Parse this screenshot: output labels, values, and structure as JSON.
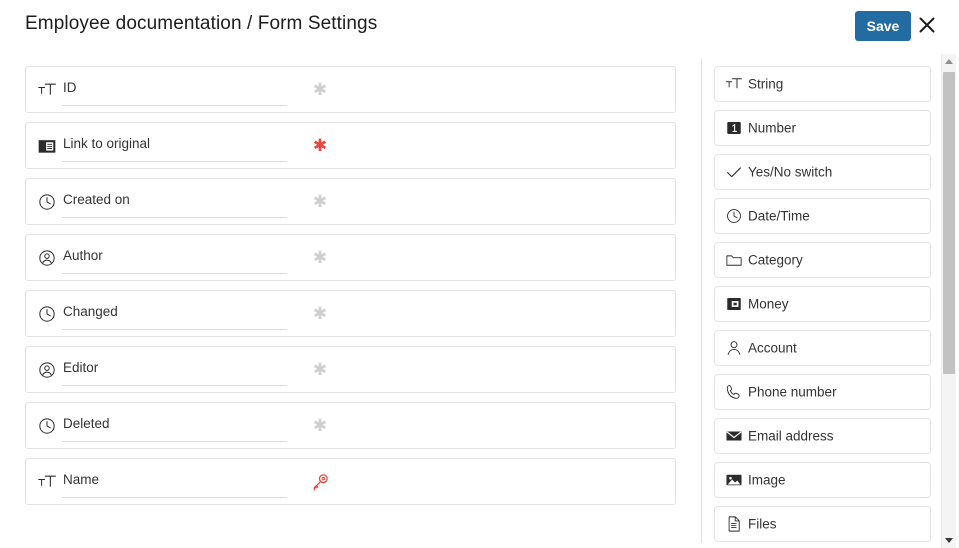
{
  "header": {
    "title": "Employee documentation / Form Settings",
    "save_label": "Save",
    "close_icon": "close-icon",
    "accent_color": "#236ca3"
  },
  "colors": {
    "accent": "#236ca3",
    "required_marker": "#e8453c",
    "optional_marker": "#cfcfcf",
    "key_marker": "#e8453c",
    "row_border": "#e3e3e3",
    "text": "#333333"
  },
  "form": {
    "rows": [
      {
        "label": "ID",
        "icon": "text-format-icon",
        "marker": "asterisk",
        "marker_tone": "grey"
      },
      {
        "label": "Link to original",
        "icon": "page-layout-icon",
        "marker": "asterisk",
        "marker_tone": "red"
      },
      {
        "label": "Created on",
        "icon": "clock-icon",
        "marker": "asterisk",
        "marker_tone": "grey"
      },
      {
        "label": "Author",
        "icon": "user-circle-icon",
        "marker": "asterisk",
        "marker_tone": "grey"
      },
      {
        "label": "Changed",
        "icon": "clock-icon",
        "marker": "asterisk",
        "marker_tone": "grey"
      },
      {
        "label": "Editor",
        "icon": "user-circle-icon",
        "marker": "asterisk",
        "marker_tone": "grey"
      },
      {
        "label": "Deleted",
        "icon": "clock-icon",
        "marker": "asterisk",
        "marker_tone": "grey"
      },
      {
        "label": "Name",
        "icon": "text-format-icon",
        "marker": "key",
        "marker_tone": "red"
      }
    ],
    "marker_asterisk_glyph": "✱"
  },
  "palette": {
    "items": [
      {
        "label": "String",
        "icon": "text-format-icon"
      },
      {
        "label": "Number",
        "icon": "number-box-icon"
      },
      {
        "label": "Yes/No switch",
        "icon": "check-icon"
      },
      {
        "label": "Date/Time",
        "icon": "clock-icon"
      },
      {
        "label": "Category",
        "icon": "folder-icon"
      },
      {
        "label": "Money",
        "icon": "money-box-icon"
      },
      {
        "label": "Account",
        "icon": "user-icon"
      },
      {
        "label": "Phone number",
        "icon": "phone-icon"
      },
      {
        "label": "Email address",
        "icon": "envelope-icon"
      },
      {
        "label": "Image",
        "icon": "image-icon"
      },
      {
        "label": "Files",
        "icon": "document-icon"
      }
    ]
  },
  "scrollbar": {
    "up_icon": "triangle-up-icon",
    "down_icon": "triangle-down-icon",
    "thumb": "scroll-thumb"
  }
}
